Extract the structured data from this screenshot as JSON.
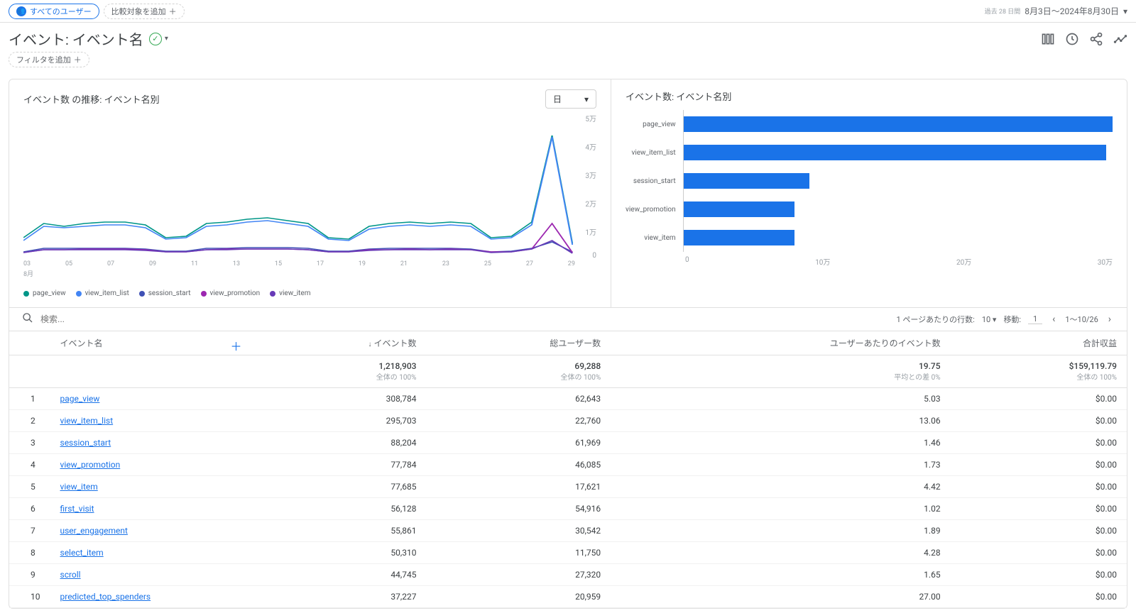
{
  "top": {
    "all_users": "すべてのユーザー",
    "add_comparison": "比較対象を追加",
    "date_sub": "過去 28 日間",
    "date_range": "8月3日～2024年8月30日"
  },
  "title": "イベント: イベント名",
  "filter": {
    "add": "フィルタを追加"
  },
  "charts": {
    "line_title": "イベント数 の推移: イベント名別",
    "bar_title": "イベント数: イベント名別",
    "granularity": "日",
    "yaxis": [
      "5万",
      "4万",
      "3万",
      "2万",
      "1万",
      "0"
    ],
    "xaxis": [
      "03",
      "05",
      "07",
      "09",
      "11",
      "13",
      "15",
      "17",
      "19",
      "21",
      "23",
      "25",
      "27",
      "29"
    ],
    "xaxis_sub": "8月",
    "legend": [
      {
        "name": "page_view",
        "color": "#009688"
      },
      {
        "name": "view_item_list",
        "color": "#4285f4"
      },
      {
        "name": "session_start",
        "color": "#3f51b5"
      },
      {
        "name": "view_promotion",
        "color": "#9c27b0"
      },
      {
        "name": "view_item",
        "color": "#673ab7"
      }
    ],
    "bars": {
      "labels": [
        "page_view",
        "view_item_list",
        "session_start",
        "view_promotion",
        "view_item"
      ],
      "xaxis": [
        "0",
        "10万",
        "20万",
        "30万"
      ]
    }
  },
  "search": {
    "placeholder": "検索...",
    "rows_per_page_label": "1 ページあたりの行数:",
    "rows_per_page": "10",
    "goto_label": "移動:",
    "goto": "1",
    "range": "1～10/26"
  },
  "table": {
    "headers": {
      "event_name": "イベント名",
      "event_count": "イベント数",
      "total_users": "総ユーザー数",
      "events_per_user": "ユーザーあたりのイベント数",
      "total_revenue": "合計収益"
    },
    "totals": {
      "event_count": "1,218,903",
      "event_count_sub": "全体の 100%",
      "total_users": "69,288",
      "total_users_sub": "全体の 100%",
      "events_per_user": "19.75",
      "events_per_user_sub": "平均との差 0%",
      "total_revenue": "$159,119.79",
      "total_revenue_sub": "全体の 100%"
    },
    "rows": [
      {
        "n": "1",
        "name": "page_view",
        "count": "308,784",
        "users": "62,643",
        "per": "5.03",
        "rev": "$0.00"
      },
      {
        "n": "2",
        "name": "view_item_list",
        "count": "295,703",
        "users": "22,760",
        "per": "13.06",
        "rev": "$0.00"
      },
      {
        "n": "3",
        "name": "session_start",
        "count": "88,204",
        "users": "61,969",
        "per": "1.46",
        "rev": "$0.00"
      },
      {
        "n": "4",
        "name": "view_promotion",
        "count": "77,784",
        "users": "46,085",
        "per": "1.73",
        "rev": "$0.00"
      },
      {
        "n": "5",
        "name": "view_item",
        "count": "77,685",
        "users": "17,621",
        "per": "4.42",
        "rev": "$0.00"
      },
      {
        "n": "6",
        "name": "first_visit",
        "count": "56,128",
        "users": "54,916",
        "per": "1.02",
        "rev": "$0.00"
      },
      {
        "n": "7",
        "name": "user_engagement",
        "count": "55,861",
        "users": "30,542",
        "per": "1.89",
        "rev": "$0.00"
      },
      {
        "n": "8",
        "name": "select_item",
        "count": "50,310",
        "users": "11,750",
        "per": "4.28",
        "rev": "$0.00"
      },
      {
        "n": "9",
        "name": "scroll",
        "count": "44,745",
        "users": "27,320",
        "per": "1.65",
        "rev": "$0.00"
      },
      {
        "n": "10",
        "name": "predicted_top_spenders",
        "count": "37,227",
        "users": "20,959",
        "per": "27.00",
        "rev": "$0.00"
      }
    ]
  },
  "chart_data": [
    {
      "type": "line",
      "title": "イベント数 の推移: イベント名別",
      "xlabel": "8月",
      "ylabel": "",
      "ylim": [
        0,
        50000
      ],
      "x": [
        3,
        4,
        5,
        6,
        7,
        8,
        9,
        10,
        11,
        12,
        13,
        14,
        15,
        16,
        17,
        18,
        19,
        20,
        21,
        22,
        23,
        24,
        25,
        26,
        27,
        28,
        29,
        30
      ],
      "series": [
        {
          "name": "page_view",
          "values": [
            7000,
            12000,
            11000,
            12000,
            12500,
            12500,
            11500,
            7000,
            7500,
            12000,
            12500,
            13500,
            14000,
            13000,
            12000,
            7000,
            6500,
            11000,
            12000,
            12500,
            12000,
            12500,
            12000,
            7000,
            7500,
            12500,
            43000,
            5000
          ]
        },
        {
          "name": "view_item_list",
          "values": [
            6000,
            11000,
            10500,
            11000,
            11500,
            11500,
            10500,
            6500,
            7000,
            11000,
            11500,
            12500,
            13000,
            12000,
            11000,
            6500,
            6000,
            10000,
            11000,
            11500,
            11000,
            11500,
            11000,
            6500,
            7000,
            11500,
            42500,
            4500
          ]
        },
        {
          "name": "session_start",
          "values": [
            2000,
            3200,
            3200,
            3200,
            3200,
            3200,
            3000,
            2200,
            2300,
            3200,
            3300,
            3500,
            3500,
            3400,
            3200,
            2200,
            2200,
            3000,
            3200,
            3200,
            3200,
            3200,
            3100,
            2100,
            2200,
            3300,
            5500,
            2000
          ]
        },
        {
          "name": "view_promotion",
          "values": [
            1800,
            2800,
            2800,
            2900,
            2900,
            2900,
            2700,
            2000,
            2100,
            2800,
            2900,
            3000,
            3100,
            3000,
            2800,
            2000,
            2000,
            2700,
            2800,
            2900,
            2800,
            2900,
            2800,
            1900,
            2000,
            3000,
            12000,
            1700
          ]
        },
        {
          "name": "view_item",
          "values": [
            1700,
            2700,
            2700,
            2800,
            2800,
            2800,
            2600,
            1900,
            2000,
            2700,
            2800,
            2900,
            3000,
            2900,
            2700,
            1900,
            1900,
            2600,
            2700,
            2800,
            2700,
            2800,
            2700,
            1800,
            1900,
            2900,
            6000,
            1600
          ]
        }
      ]
    },
    {
      "type": "bar",
      "title": "イベント数: イベント名別",
      "categories": [
        "page_view",
        "view_item_list",
        "session_start",
        "view_promotion",
        "view_item"
      ],
      "values": [
        308784,
        295703,
        88204,
        77784,
        77685
      ],
      "xlim": [
        0,
        300000
      ]
    }
  ]
}
